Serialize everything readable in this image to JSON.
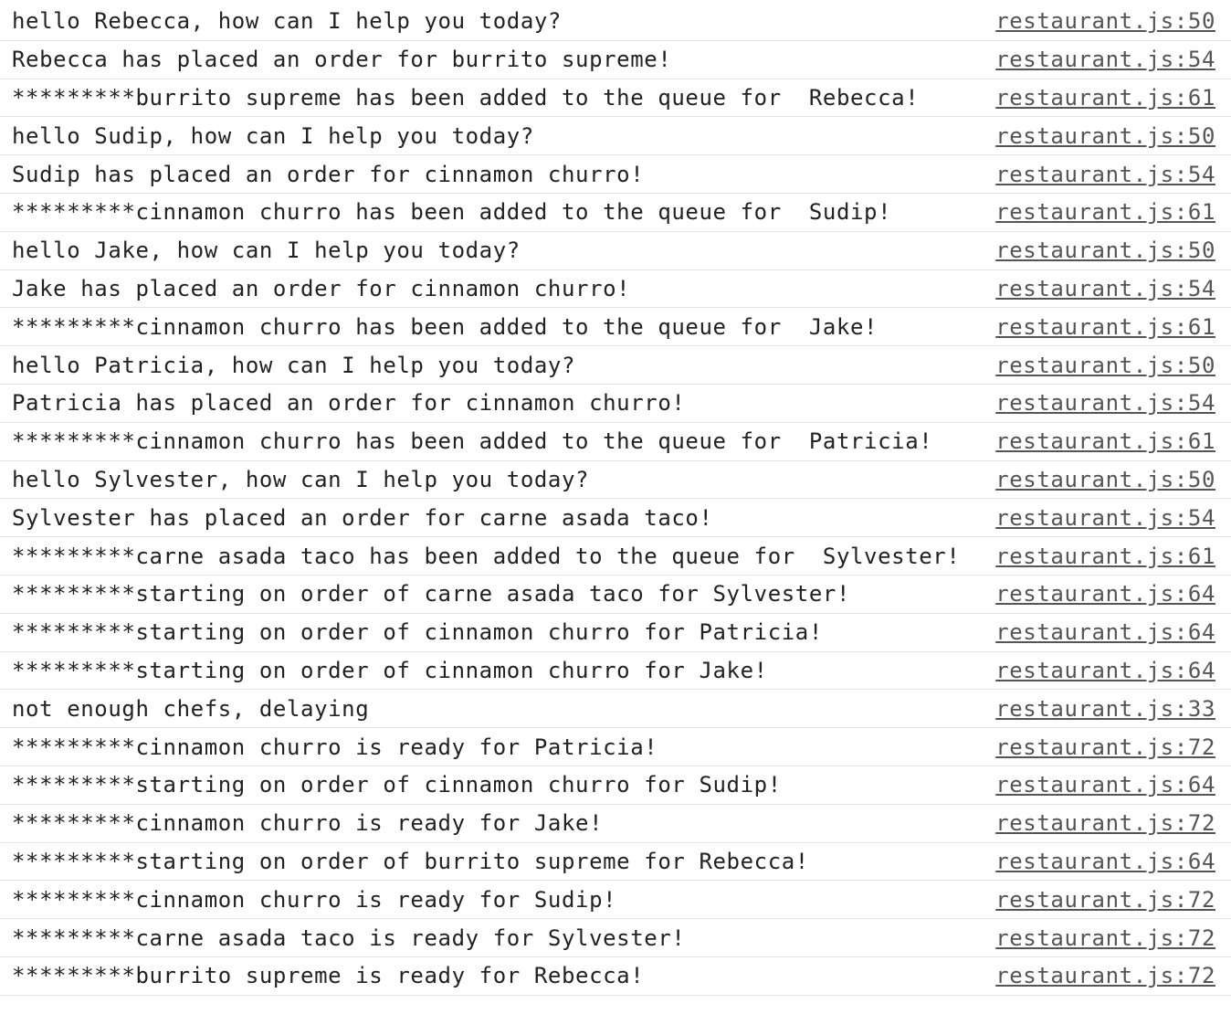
{
  "console": {
    "logs": [
      {
        "message": "hello Rebecca, how can I help you today?",
        "source": "restaurant.js:50"
      },
      {
        "message": "Rebecca has placed an order for burrito supreme!",
        "source": "restaurant.js:54"
      },
      {
        "message": "*********burrito supreme has been added to the queue for  Rebecca!",
        "source": "restaurant.js:61"
      },
      {
        "message": "hello Sudip, how can I help you today?",
        "source": "restaurant.js:50"
      },
      {
        "message": "Sudip has placed an order for cinnamon churro!",
        "source": "restaurant.js:54"
      },
      {
        "message": "*********cinnamon churro has been added to the queue for  Sudip!",
        "source": "restaurant.js:61"
      },
      {
        "message": "hello Jake, how can I help you today?",
        "source": "restaurant.js:50"
      },
      {
        "message": "Jake has placed an order for cinnamon churro!",
        "source": "restaurant.js:54"
      },
      {
        "message": "*********cinnamon churro has been added to the queue for  Jake!",
        "source": "restaurant.js:61"
      },
      {
        "message": "hello Patricia, how can I help you today?",
        "source": "restaurant.js:50"
      },
      {
        "message": "Patricia has placed an order for cinnamon churro!",
        "source": "restaurant.js:54"
      },
      {
        "message": "*********cinnamon churro has been added to the queue for  Patricia!",
        "source": "restaurant.js:61"
      },
      {
        "message": "hello Sylvester, how can I help you today?",
        "source": "restaurant.js:50"
      },
      {
        "message": "Sylvester has placed an order for carne asada taco!",
        "source": "restaurant.js:54"
      },
      {
        "message": "*********carne asada taco has been added to the queue for  Sylvester!",
        "source": "restaurant.js:61"
      },
      {
        "message": "*********starting on order of carne asada taco for Sylvester!",
        "source": "restaurant.js:64"
      },
      {
        "message": "*********starting on order of cinnamon churro for Patricia!",
        "source": "restaurant.js:64"
      },
      {
        "message": "*********starting on order of cinnamon churro for Jake!",
        "source": "restaurant.js:64"
      },
      {
        "message": "not enough chefs, delaying",
        "source": "restaurant.js:33"
      },
      {
        "message": "*********cinnamon churro is ready for Patricia!",
        "source": "restaurant.js:72"
      },
      {
        "message": "*********starting on order of cinnamon churro for Sudip!",
        "source": "restaurant.js:64"
      },
      {
        "message": "*********cinnamon churro is ready for Jake!",
        "source": "restaurant.js:72"
      },
      {
        "message": "*********starting on order of burrito supreme for Rebecca!",
        "source": "restaurant.js:64"
      },
      {
        "message": "*********cinnamon churro is ready for Sudip!",
        "source": "restaurant.js:72"
      },
      {
        "message": "*********carne asada taco is ready for Sylvester!",
        "source": "restaurant.js:72"
      },
      {
        "message": "*********burrito supreme is ready for Rebecca!",
        "source": "restaurant.js:72"
      }
    ]
  }
}
